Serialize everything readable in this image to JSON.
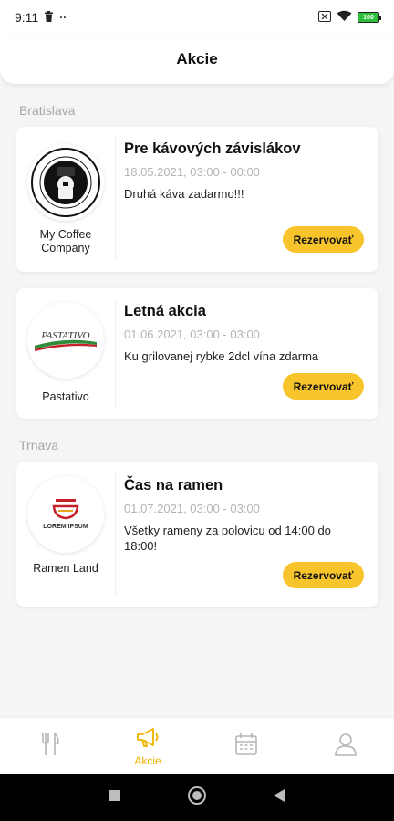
{
  "status_bar": {
    "time": "9:11",
    "battery_level": "100"
  },
  "header": {
    "title": "Akcie"
  },
  "sections": [
    {
      "label": "Bratislava"
    },
    {
      "label": "Trnava"
    }
  ],
  "cards": [
    {
      "shop_name": "My Coffee Company",
      "logo_ring_text": "COMPANY COFFEE SHOP",
      "offer_title": "Pre kávových závislákov",
      "date": "18.05.2021, 03:00 - 00:00",
      "description": "Druhá káva zadarmo!!!",
      "button_label": "Rezervovať"
    },
    {
      "shop_name": "Pastativo",
      "logo_text": "PASTATIVO",
      "offer_title": "Letná akcia",
      "date": "01.06.2021, 03:00 - 03:00",
      "description": "Ku grilovanej rybke 2dcl vína zdarma",
      "button_label": "Rezervovať"
    },
    {
      "shop_name": "Ramen Land",
      "logo_text": "LOREM IPSUM",
      "offer_title": "Čas na ramen",
      "date": "01.07.2021, 03:00 - 03:00",
      "description": "Všetky rameny za polovicu od 14:00 do 18:00!",
      "button_label": "Rezervovať"
    }
  ],
  "bottom_nav": {
    "items": [
      {
        "icon": "restaurant-icon",
        "label": ""
      },
      {
        "icon": "megaphone-icon",
        "label": "Akcie",
        "active": true
      },
      {
        "icon": "calendar-icon",
        "label": ""
      },
      {
        "icon": "user-icon",
        "label": ""
      }
    ]
  },
  "colors": {
    "accent": "#f8c42c",
    "active_nav": "#f0b400",
    "background": "#f5f5f5"
  }
}
